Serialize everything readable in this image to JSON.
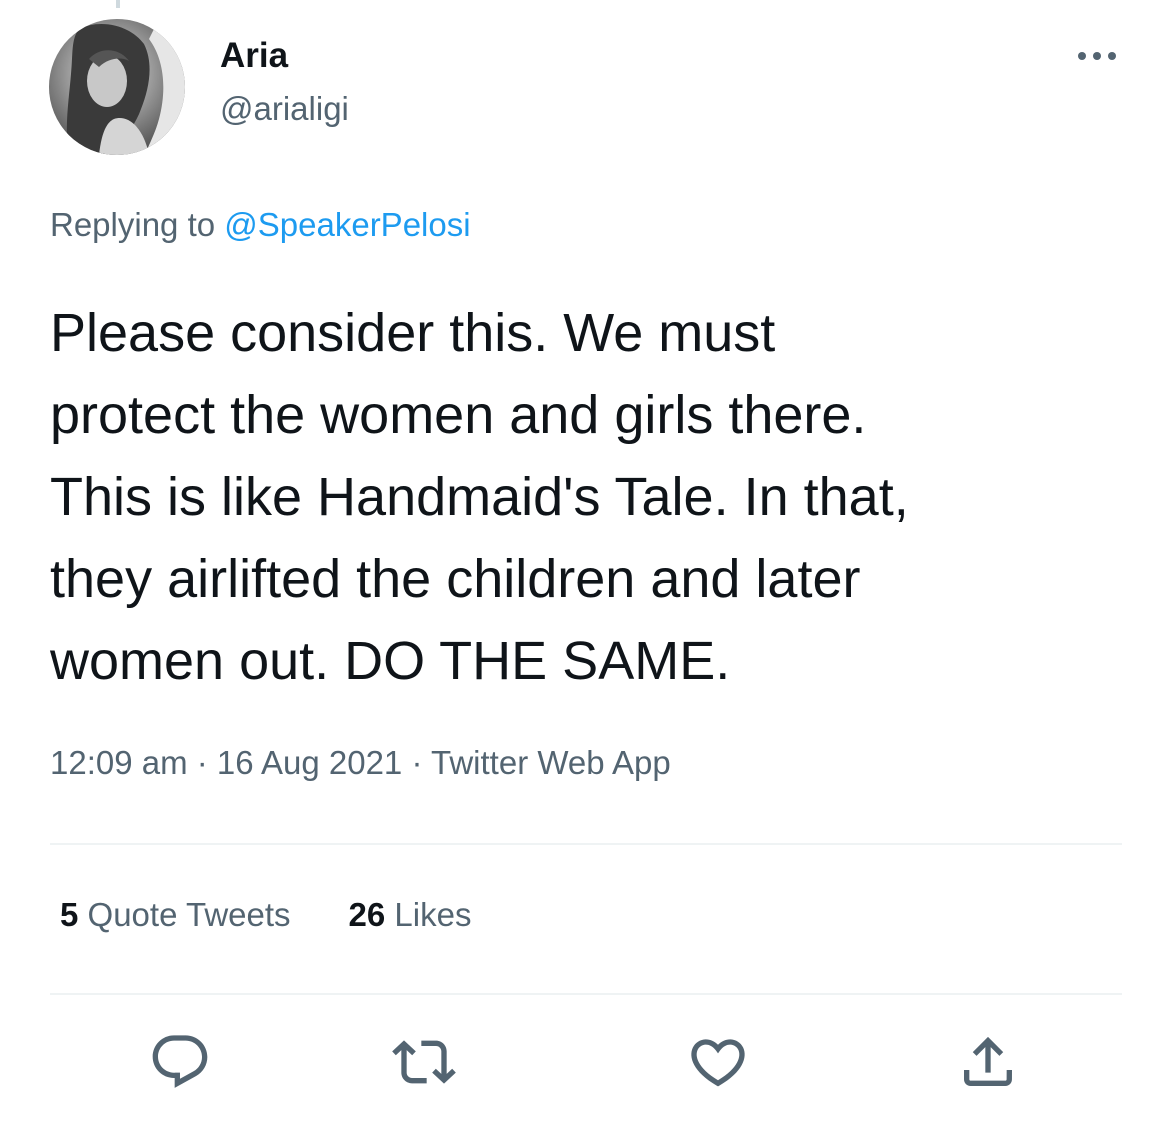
{
  "author": {
    "display_name": "Aria",
    "handle": "@arialigi",
    "avatar_icon": "profile-photo"
  },
  "reply": {
    "prefix": "Replying to ",
    "mention": "@SpeakerPelosi"
  },
  "tweet": {
    "lines": [
      "Please consider this. We must",
      "protect the women and girls there.",
      "This is like Handmaid's Tale. In that,",
      "they airlifted the children and later",
      "women out. DO THE SAME."
    ]
  },
  "meta": {
    "time": "12:09 am",
    "separator": " · ",
    "date": "16 Aug 2021",
    "source": "Twitter Web App"
  },
  "stats": {
    "quote_count": "5",
    "quote_label": " Quote Tweets",
    "like_count": "26",
    "like_label": " Likes"
  },
  "actions": [
    {
      "icon": "reply-icon"
    },
    {
      "icon": "retweet-icon"
    },
    {
      "icon": "like-icon"
    },
    {
      "icon": "share-icon"
    }
  ],
  "colors": {
    "text": "#0f1419",
    "secondary": "#536471",
    "accent": "#1d9bf0",
    "divider": "#eff3f4"
  }
}
